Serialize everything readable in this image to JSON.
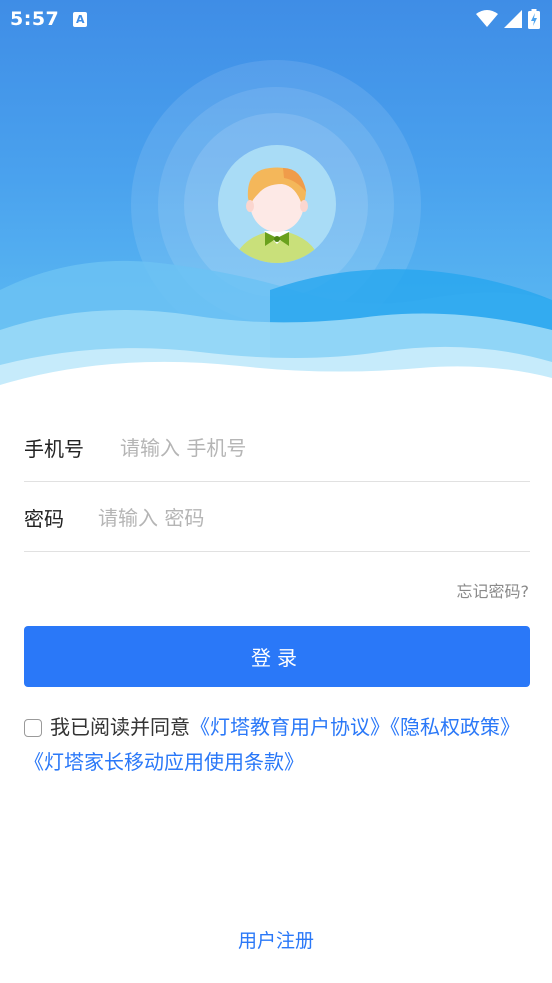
{
  "status_bar": {
    "time": "5:57",
    "notification_icon": "A",
    "icons": [
      "wifi-icon",
      "signal-icon",
      "battery-charging-icon"
    ]
  },
  "colors": {
    "header_top": "#3f8de6",
    "header_bottom": "#62c3f4",
    "accent": "#2a78f8"
  },
  "form": {
    "phone_label": "手机号",
    "phone_placeholder": "请输入 手机号",
    "phone_value": "",
    "password_label": "密码",
    "password_placeholder": "请输入 密码",
    "password_value": "",
    "forgot_password": "忘记密码?",
    "login_button": "登录"
  },
  "agreement": {
    "checked": false,
    "prefix": "我已阅读并同意",
    "link1": "《灯塔教育用户协议》",
    "link2": "《隐私权政策》",
    "link3": "《灯塔家长移动应用使用条款》"
  },
  "footer": {
    "register_link": "用户注册"
  }
}
